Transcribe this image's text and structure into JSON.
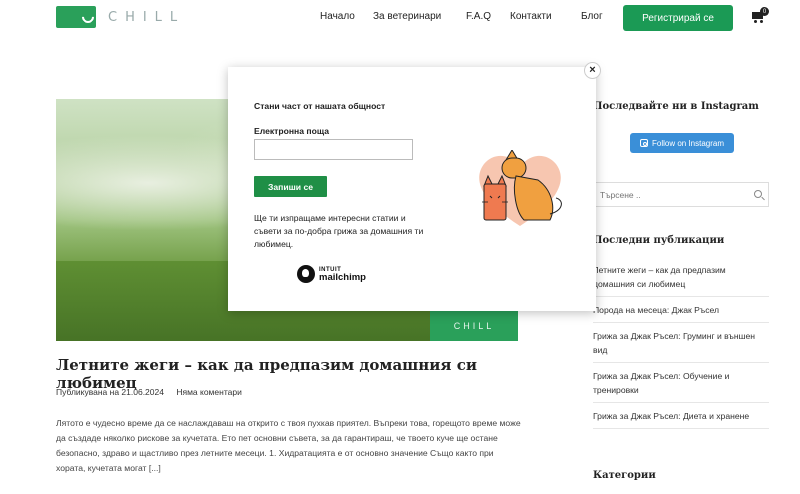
{
  "header": {
    "logo_text": "CHILL",
    "nav": [
      {
        "label": "Начало"
      },
      {
        "label": "За ветеринари"
      },
      {
        "label": "F.A.Q"
      },
      {
        "label": "Контакти"
      },
      {
        "label": "Блог"
      }
    ],
    "register_label": "Регистрирай се",
    "cart_count": "0"
  },
  "hero": {
    "badge_text": "CHILL"
  },
  "post": {
    "title": "Летните жеги – как да предпазим домашния си любимец",
    "published": "Публикувана на 21.06.2024",
    "comments": "Няма коментари",
    "excerpt": "Лятото е чудесно време да се наслаждаваш на открито с твоя пухкав приятел. Въпреки това, горещото време може да създаде няколко рискове за кучетата. Ето пет основни съвета, за да гарантираш, че твоето куче ще остане безопасно, здраво и щастливо през летните месеци. 1. Хидратацията е от основно значение Също както при хората, кучетата могат [...]"
  },
  "sidebar": {
    "instagram_heading": "Последвайте ни в Instagram",
    "instagram_button": "Follow on Instagram",
    "search_placeholder": "Търсене ..",
    "recent_heading": "Последни публикации",
    "recent": [
      {
        "label": "Летните жеги – как да предпазим домашния си любимец"
      },
      {
        "label": "Порода на месеца: Джак Ръсел"
      },
      {
        "label": "Грижа за Джак Ръсел: Груминг и външен вид"
      },
      {
        "label": "Грижа за Джак Ръсел: Обучение и тренировки"
      },
      {
        "label": "Грижа за Джак Ръсел: Диета и хранене"
      }
    ],
    "categories_heading": "Категории"
  },
  "modal": {
    "close": "×",
    "heading": "Стани част от нашата общност",
    "email_label": "Електронна поща",
    "email_value": "",
    "subscribe_label": "Запиши се",
    "description": "Ще ти изпращаме интересни статии и съвети за по-добра грижа за домашния ти любимец.",
    "mc_brand_top": "INTUIT",
    "mc_brand": "mailchimp"
  },
  "colors": {
    "brand_green": "#1b9a55",
    "instagram_blue": "#3a8fd8",
    "pet_orange": "#f0a040",
    "pet_heart": "#f7c6b0"
  }
}
